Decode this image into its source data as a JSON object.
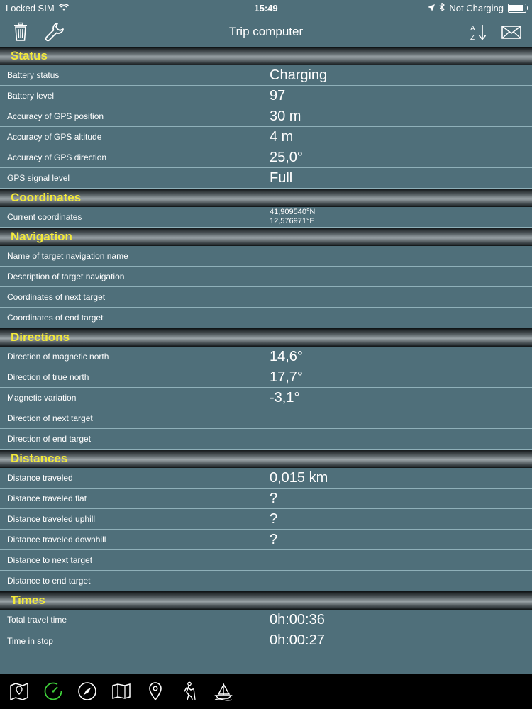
{
  "status_bar": {
    "carrier": "Locked SIM",
    "time": "15:49",
    "battery_text": "Not Charging"
  },
  "nav": {
    "title": "Trip computer",
    "left_icons": [
      "trash-icon",
      "wrench-icon"
    ],
    "right_icons": [
      "sort-az-icon",
      "mail-icon"
    ]
  },
  "sections": [
    {
      "title": "Status",
      "rows": [
        {
          "label": "Battery status",
          "value": "Charging"
        },
        {
          "label": "Battery level",
          "value": "97"
        },
        {
          "label": "Accuracy of GPS position",
          "value": "30 m"
        },
        {
          "label": "Accuracy of GPS altitude",
          "value": "4 m"
        },
        {
          "label": "Accuracy of GPS direction",
          "value": "25,0°"
        },
        {
          "label": "GPS signal level",
          "value": "Full"
        }
      ]
    },
    {
      "title": "Coordinates",
      "rows": [
        {
          "label": "Current coordinates",
          "value": "",
          "lat": "41,909540°N",
          "lon": "12,576971°E"
        }
      ]
    },
    {
      "title": "Navigation",
      "rows": [
        {
          "label": "Name of target navigation name",
          "value": ""
        },
        {
          "label": "Description of target navigation",
          "value": ""
        },
        {
          "label": "Coordinates of next target",
          "value": ""
        },
        {
          "label": "Coordinates of end target",
          "value": ""
        }
      ]
    },
    {
      "title": "Directions",
      "rows": [
        {
          "label": "Direction of magnetic north",
          "value": "14,6°"
        },
        {
          "label": "Direction of true north",
          "value": "17,7°"
        },
        {
          "label": "Magnetic variation",
          "value": "-3,1°"
        },
        {
          "label": "Direction of next target",
          "value": ""
        },
        {
          "label": "Direction of end target",
          "value": ""
        }
      ]
    },
    {
      "title": "Distances",
      "rows": [
        {
          "label": "Distance traveled",
          "value": "0,015 km"
        },
        {
          "label": "Distance traveled flat",
          "value": "?"
        },
        {
          "label": "Distance traveled uphill",
          "value": "?"
        },
        {
          "label": "Distance traveled downhill",
          "value": "?"
        },
        {
          "label": "Distance to next target",
          "value": ""
        },
        {
          "label": "Distance to end target",
          "value": ""
        }
      ]
    },
    {
      "title": "Times",
      "rows": [
        {
          "label": "Total travel time",
          "value": "0h:00:36"
        },
        {
          "label": "Time in stop",
          "value": "0h:00:27"
        }
      ]
    }
  ],
  "tab_bar": {
    "icons": [
      "map-icon",
      "trip-computer-icon",
      "compass-icon",
      "folded-map-icon",
      "location-pin-icon",
      "hiker-icon",
      "sailboat-icon"
    ],
    "active_color": "#3fd13a"
  }
}
